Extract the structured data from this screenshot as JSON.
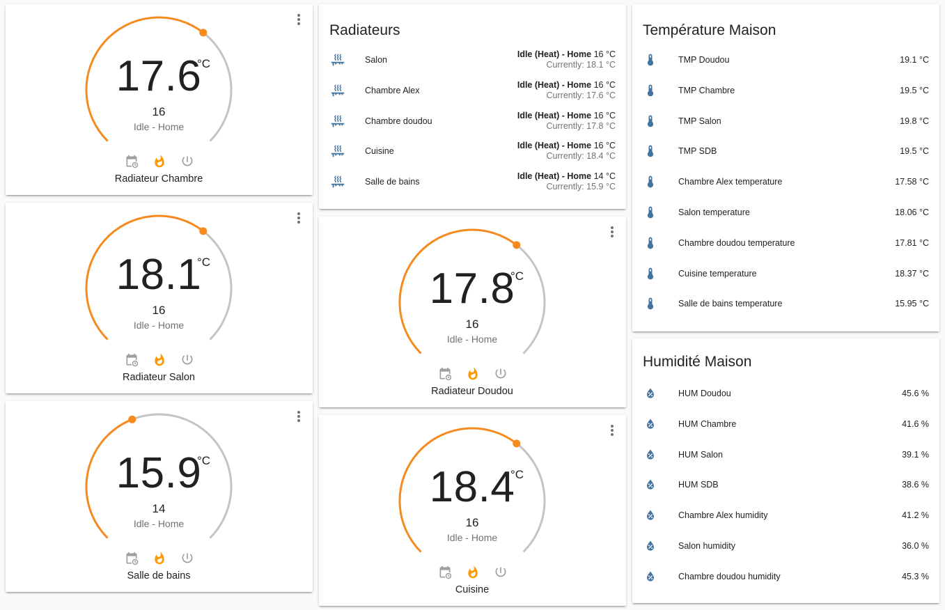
{
  "colors": {
    "accent": "#ff9800",
    "arc_orange": "#f58a1f",
    "arc_gray": "#c4c4c4",
    "icon_blue": "#44739e",
    "muted": "#727272"
  },
  "icons": {
    "menu": "dots-vertical-icon",
    "schedule": "calendar-sync-icon",
    "heat": "fire-icon",
    "off": "power-icon",
    "radiator": "radiator-icon",
    "thermometer": "thermometer-icon",
    "humidity": "water-percent-icon"
  },
  "thermostats": [
    {
      "name": "Radiateur Chambre",
      "temperature": "17.6",
      "unit": "°C",
      "setpoint": "16",
      "status": "Idle - Home",
      "setpoint_position": 0.64
    },
    {
      "name": "Radiateur Salon",
      "temperature": "18.1",
      "unit": "°C",
      "setpoint": "16",
      "status": "Idle - Home",
      "setpoint_position": 0.64
    },
    {
      "name": "Salle de bains",
      "temperature": "15.9",
      "unit": "°C",
      "setpoint": "14",
      "status": "Idle - Home",
      "setpoint_position": 0.42
    },
    {
      "name": "Radiateur Doudou",
      "temperature": "17.8",
      "unit": "°C",
      "setpoint": "16",
      "status": "Idle - Home",
      "setpoint_position": 0.64
    },
    {
      "name": "Cuisine",
      "temperature": "18.4",
      "unit": "°C",
      "setpoint": "16",
      "status": "Idle - Home",
      "setpoint_position": 0.64
    }
  ],
  "radiateurs": {
    "title": "Radiateurs",
    "items": [
      {
        "name": "Salon",
        "state": "Idle (Heat) - Home",
        "target": "16 °C",
        "current": "Currently: 18.1 °C"
      },
      {
        "name": "Chambre Alex",
        "state": "Idle (Heat) - Home",
        "target": "16 °C",
        "current": "Currently: 17.6 °C"
      },
      {
        "name": "Chambre doudou",
        "state": "Idle (Heat) - Home",
        "target": "16 °C",
        "current": "Currently: 17.8 °C"
      },
      {
        "name": "Cuisine",
        "state": "Idle (Heat) - Home",
        "target": "16 °C",
        "current": "Currently: 18.4 °C"
      },
      {
        "name": "Salle de bains",
        "state": "Idle (Heat) - Home",
        "target": "14 °C",
        "current": "Currently: 15.9 °C"
      }
    ]
  },
  "temperature": {
    "title": "Température Maison",
    "items": [
      {
        "name": "TMP Doudou",
        "value": "19.1 °C"
      },
      {
        "name": "TMP Chambre",
        "value": "19.5 °C"
      },
      {
        "name": "TMP Salon",
        "value": "19.8 °C"
      },
      {
        "name": "TMP SDB",
        "value": "19.5 °C"
      },
      {
        "name": "Chambre Alex temperature",
        "value": "17.58 °C"
      },
      {
        "name": "Salon temperature",
        "value": "18.06 °C"
      },
      {
        "name": "Chambre doudou temperature",
        "value": "17.81 °C"
      },
      {
        "name": "Cuisine temperature",
        "value": "18.37 °C"
      },
      {
        "name": "Salle de bains temperature",
        "value": "15.95 °C"
      }
    ]
  },
  "humidity": {
    "title": "Humidité Maison",
    "items": [
      {
        "name": "HUM Doudou",
        "value": "45.6 %"
      },
      {
        "name": "HUM Chambre",
        "value": "41.6 %"
      },
      {
        "name": "HUM Salon",
        "value": "39.1 %"
      },
      {
        "name": "HUM SDB",
        "value": "38.6 %"
      },
      {
        "name": "Chambre Alex humidity",
        "value": "41.2 %"
      },
      {
        "name": "Salon humidity",
        "value": "36.0 %"
      },
      {
        "name": "Chambre doudou humidity",
        "value": "45.3 %"
      }
    ]
  }
}
